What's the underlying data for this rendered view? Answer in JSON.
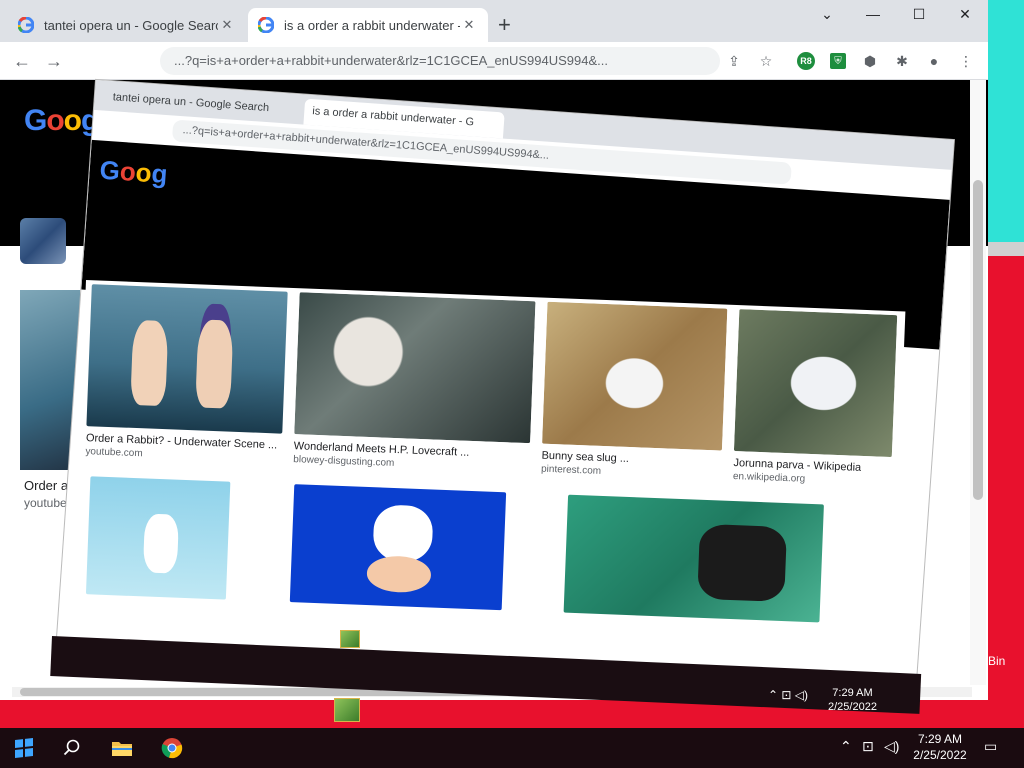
{
  "browser": {
    "tabs": [
      {
        "title": "tantei opera un - Google Search",
        "active": false
      },
      {
        "title": "is a order a rabbit underwater - G",
        "active": true
      }
    ],
    "new_tab": "+",
    "url": "...?q=is+a+order+a+rabbit+underwater&rlz=1C1GCEA_enUS994US994&...",
    "extensions": [
      "R8",
      "shield-ext",
      "puzzle-extensions"
    ],
    "window_controls": [
      "minimize",
      "maximize",
      "close"
    ]
  },
  "search_page": {
    "logo": [
      "G",
      "o",
      "o",
      "g"
    ],
    "left_result": {
      "caption": "Order a",
      "source": "youtube"
    }
  },
  "inner_window": {
    "tabs": [
      {
        "title": "tantei opera un - Google Search"
      },
      {
        "title": "is a order a rabbit underwater - G"
      }
    ],
    "url": "...?q=is+a+order+a+rabbit+underwater&rlz=1C1GCEA_enUS994US994&...",
    "clock_time": "7:29 AM",
    "clock_date": "2/25/2022"
  },
  "results": [
    {
      "caption": "Order a Rabbit? - Underwater Scene ...",
      "source": "youtube.com",
      "kind": "anime"
    },
    {
      "caption": "Wonderland Meets H.P. Lovecraft ...",
      "source": "blowey-disgusting.com",
      "kind": "rabbit"
    },
    {
      "caption": "Bunny sea slug ...",
      "source": "pinterest.com",
      "kind": "slug"
    },
    {
      "caption": "Jorunna parva - Wikipedia",
      "source": "en.wikipedia.org",
      "kind": "slug2"
    },
    {
      "caption": "",
      "source": "",
      "kind": "bunny-blue"
    },
    {
      "caption": "",
      "source": "",
      "kind": "bunny-cartoon"
    },
    {
      "caption": "",
      "source": "",
      "kind": "diver"
    }
  ],
  "desktop": {
    "recycle_bin_label": "Bin",
    "recycle_bin_label_inner": "Bin"
  },
  "taskbar": {
    "time": "7:29 AM",
    "date": "2/25/2022",
    "pinned": [
      "start",
      "search",
      "file-explorer",
      "chrome"
    ],
    "tray": [
      "chevron-up",
      "network",
      "volume",
      "notifications"
    ]
  },
  "colors": {
    "desktop_bg": "#e8112d",
    "accent_cyan": "#2fe2d6",
    "taskbar": "#1a0b10",
    "chrome_tabstrip": "#dee1e6"
  }
}
